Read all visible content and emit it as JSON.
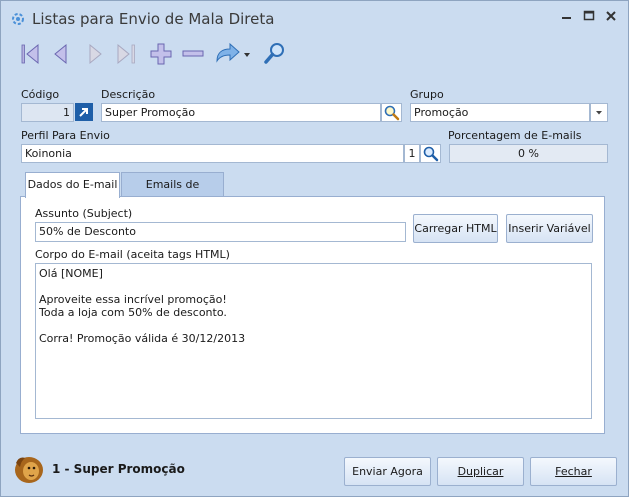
{
  "window": {
    "title": "Listas para Envio de Mala Direta",
    "controls": [
      "minimize",
      "maximize",
      "close"
    ]
  },
  "toolbar": {
    "buttons": [
      "first",
      "previous",
      "next",
      "last",
      "add",
      "remove",
      "redo",
      "dropdown",
      "search"
    ]
  },
  "form": {
    "codigo_label": "Código",
    "codigo_value": "1",
    "descricao_label": "Descrição",
    "descricao_value": "Super Promoção",
    "grupo_label": "Grupo",
    "grupo_value": "Promoção",
    "perfil_label": "Perfil Para Envio",
    "perfil_value": "Koinonia",
    "perfil_code": "1",
    "porcentagem_label": "Porcentagem de E-mails Enviados",
    "porcentagem_value": "0 %",
    "porcentagem_fraction": 0
  },
  "tabs": [
    {
      "label": "Dados do E-mail",
      "active": true
    },
    {
      "label": "Emails de Clientes",
      "active": false
    }
  ],
  "email": {
    "assunto_label": "Assunto (Subject)",
    "assunto_value": "50% de Desconto",
    "carregar_html_label": "Carregar HTML",
    "inserir_variavel_label": "Inserir Variável",
    "corpo_label": "Corpo do E-mail (aceita tags HTML)",
    "body_lines": [
      "Olá [NOME]",
      "",
      "Aproveite essa incrível promoção!",
      "Toda a loja com 50% de desconto.",
      "",
      "Corra! Promoção válida é 30/12/2013"
    ]
  },
  "footer": {
    "record_title": "1 - Super Promoção",
    "enviar_label": "Enviar Agora",
    "duplicar_label": "Duplicar",
    "fechar_label": "Fechar"
  },
  "colors": {
    "window_bg": "#cbdcf0",
    "accent_blue": "#3a78c8",
    "border": "#a4b8d2"
  }
}
